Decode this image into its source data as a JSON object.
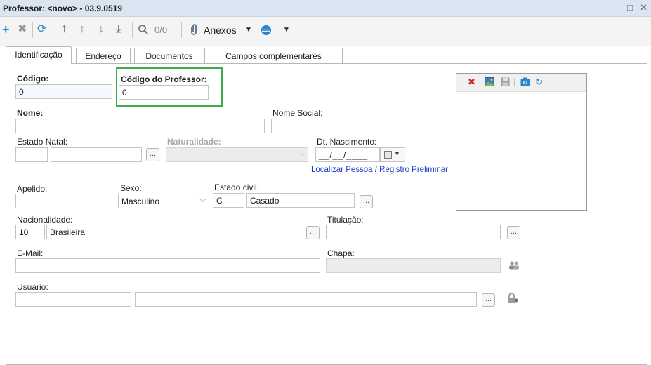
{
  "window": {
    "title": "Professor: <novo> - 03.9.0519",
    "restore_glyph": "□",
    "close_glyph": "✕"
  },
  "toolbar": {
    "record_count": "0/0",
    "attachments_label": "Anexos"
  },
  "tabs": [
    {
      "label": "Identificação",
      "active": true
    },
    {
      "label": "Endereço",
      "active": false
    },
    {
      "label": "Documentos",
      "active": false
    },
    {
      "label": "Campos complementares",
      "active": false
    }
  ],
  "form": {
    "codigo": {
      "label": "Código:",
      "value": "0"
    },
    "codigo_professor": {
      "label": "Código do Professor:",
      "value": "0"
    },
    "nome": {
      "label": "Nome:",
      "value": ""
    },
    "nome_social": {
      "label": "Nome Social:",
      "value": ""
    },
    "estado_natal": {
      "label": "Estado Natal:",
      "code": "",
      "name": ""
    },
    "naturalidade": {
      "label": "Naturalidade:",
      "value": ""
    },
    "dt_nascimento": {
      "label": "Dt. Nascimento:",
      "value": "__/__/____"
    },
    "localizar_link": "Localizar Pessoa / Registro Preliminar",
    "apelido": {
      "label": "Apelido:",
      "value": ""
    },
    "sexo": {
      "label": "Sexo:",
      "value": "Masculino"
    },
    "estado_civil": {
      "label": "Estado civil:",
      "code": "C",
      "name": "Casado"
    },
    "nacionalidade": {
      "label": "Nacionalidade:",
      "code": "10",
      "name": "Brasileira"
    },
    "titulacao": {
      "label": "Titulação:",
      "value": ""
    },
    "email": {
      "label": "E-Mail:",
      "value": ""
    },
    "chapa": {
      "label": "Chapa:",
      "value": ""
    },
    "usuario": {
      "label": "Usuário:",
      "code": "",
      "name": ""
    },
    "lookup_button": "..."
  },
  "colors": {
    "highlight": "#3cab4b",
    "titlebar": "#dbe5f1",
    "link": "#1a3fc8",
    "delete_icon": "#c92b2b",
    "accent_blue": "#2a86c9"
  },
  "icons": {
    "toolbar": [
      "plus-icon",
      "delete-icon",
      "refresh-icon",
      "first-record-icon",
      "previous-record-icon",
      "next-record-icon",
      "last-record-icon",
      "search-icon",
      "paperclip-icon",
      "globe-icon"
    ],
    "photo_toolbar": [
      "delete-photo-icon",
      "image-icon",
      "save-icon",
      "camera-icon",
      "rotate-icon"
    ]
  }
}
